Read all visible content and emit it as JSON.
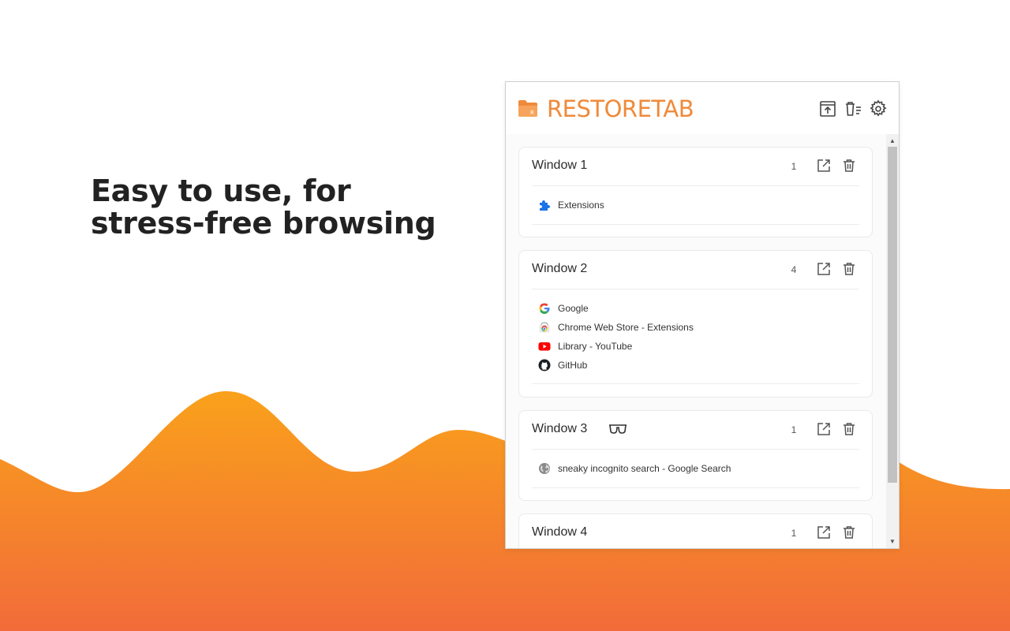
{
  "headline": {
    "line1": "Easy to use, for",
    "line2": "stress-free browsing"
  },
  "colors": {
    "wave_top": "#f9a11b",
    "wave_bottom": "#f26b3a",
    "brand": "#ef8a3a"
  },
  "app": {
    "logo_text": "RESTORETAB",
    "logo_icon": "folder-icon",
    "header_buttons": [
      {
        "name": "export-button",
        "icon": "export-icon"
      },
      {
        "name": "clear-all-button",
        "icon": "trash-list-icon"
      },
      {
        "name": "settings-button",
        "icon": "gear-icon"
      }
    ]
  },
  "windows": [
    {
      "title": "Window 1",
      "count": "1",
      "incognito": false,
      "tabs": [
        {
          "title": "Extensions",
          "icon": "puzzle-icon"
        }
      ]
    },
    {
      "title": "Window 2",
      "count": "4",
      "incognito": false,
      "tabs": [
        {
          "title": "Google",
          "icon": "google-icon"
        },
        {
          "title": "Chrome Web Store - Extensions",
          "icon": "chrome-web-store-icon"
        },
        {
          "title": "Library - YouTube",
          "icon": "youtube-icon"
        },
        {
          "title": "GitHub",
          "icon": "github-icon"
        }
      ]
    },
    {
      "title": "Window 3",
      "count": "1",
      "incognito": true,
      "incognito_icon": "incognito-glasses-icon",
      "tabs": [
        {
          "title": "sneaky incognito search - Google Search",
          "icon": "globe-icon"
        }
      ]
    },
    {
      "title": "Window 4",
      "count": "1",
      "incognito": false,
      "tabs": []
    }
  ]
}
